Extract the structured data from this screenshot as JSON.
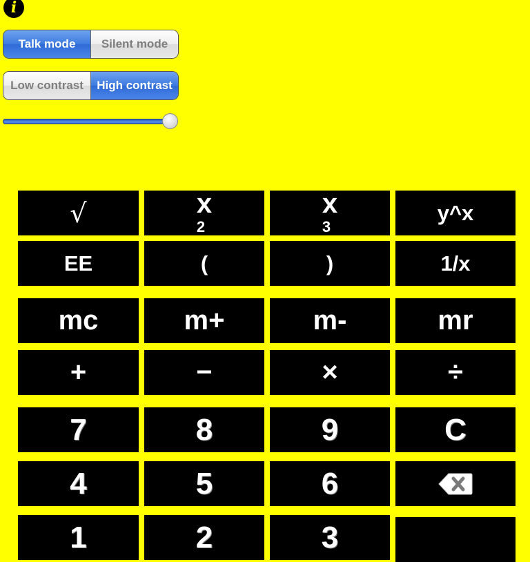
{
  "info_button": {
    "icon": "info-icon",
    "glyph": "i"
  },
  "mode_control": {
    "segments": [
      {
        "label": "Talk mode",
        "selected": true
      },
      {
        "label": "Silent mode",
        "selected": false
      }
    ]
  },
  "contrast_control": {
    "segments": [
      {
        "label": "Low contrast",
        "selected": false
      },
      {
        "label": "High contrast",
        "selected": true
      }
    ]
  },
  "volume_slider": {
    "value_fraction": 1.0
  },
  "colors": {
    "background": "#ffff00",
    "key_background": "#000000",
    "key_text": "#ffffff",
    "segment_selected": "#3e7be0",
    "segment_unselected_text": "#7f7f7f"
  },
  "keypad": {
    "rows": [
      [
        {
          "name": "square-root-key",
          "label": "√"
        },
        {
          "name": "square-key",
          "base": "x",
          "sup": "2"
        },
        {
          "name": "cube-key",
          "base": "x",
          "sup": "3"
        },
        {
          "name": "power-key",
          "label": "y^x"
        }
      ],
      [
        {
          "name": "ee-key",
          "label": "EE"
        },
        {
          "name": "open-paren-key",
          "label": "("
        },
        {
          "name": "close-paren-key",
          "label": ")"
        },
        {
          "name": "reciprocal-key",
          "label": "1/x"
        }
      ],
      [
        {
          "name": "memory-clear-key",
          "label": "mc"
        },
        {
          "name": "memory-add-key",
          "label": "m+"
        },
        {
          "name": "memory-subtract-key",
          "label": "m-"
        },
        {
          "name": "memory-recall-key",
          "label": "mr"
        }
      ],
      [
        {
          "name": "add-key",
          "label": "+"
        },
        {
          "name": "subtract-key",
          "label": "−"
        },
        {
          "name": "multiply-key",
          "label": "×"
        },
        {
          "name": "divide-key",
          "label": "÷"
        }
      ],
      [
        {
          "name": "digit-7-key",
          "label": "7"
        },
        {
          "name": "digit-8-key",
          "label": "8"
        },
        {
          "name": "digit-9-key",
          "label": "9"
        },
        {
          "name": "clear-key",
          "label": "C"
        }
      ],
      [
        {
          "name": "digit-4-key",
          "label": "4"
        },
        {
          "name": "digit-5-key",
          "label": "5"
        },
        {
          "name": "digit-6-key",
          "label": "6"
        },
        {
          "name": "backspace-key",
          "icon": "backspace-icon"
        }
      ],
      [
        {
          "name": "digit-1-key",
          "label": "1"
        },
        {
          "name": "digit-2-key",
          "label": "2"
        },
        {
          "name": "digit-3-key",
          "label": "3"
        },
        {
          "name": "equals-key",
          "label": ""
        }
      ]
    ]
  }
}
